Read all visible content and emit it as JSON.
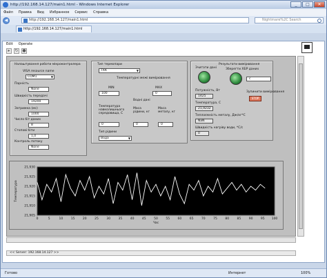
{
  "window": {
    "title": "http://192.168.14.127/main1.html - Windows Internet Explorer",
    "minimize": "_",
    "maximize": "□",
    "close": "✕"
  },
  "menubar": [
    "Файл",
    "Правка",
    "Вид",
    "Избранное",
    "Сервис",
    "Справка"
  ],
  "address": {
    "url": "http://192.168.14.127/main1.html",
    "search_placeholder": "Nightmare%2C Search"
  },
  "tab": {
    "label": "http://192.168.14.127/main1.html"
  },
  "labview": {
    "menu": [
      "Edit",
      "Operate"
    ],
    "panel_left": {
      "title": "Налаштування роботи мікроконтролера",
      "visa_label": "VISA resource name",
      "visa_value": "COM1",
      "parity_label": "Парність",
      "parity_value": "None",
      "baud_label": "Швидкість передачі",
      "baud_value": "19200",
      "delay_label": "Затримка (мс)",
      "delay_value": "1000",
      "databits_label": "Число біт даних",
      "databits_value": "8",
      "stopbits_label": "Стопові біти",
      "stopbits_value": "1,0",
      "flow_label": "Контроль потоку",
      "flow_value": "None"
    },
    "panel_middle": {
      "sensor_type_label": "Тип термопари",
      "sensor_type_value": "ТХК",
      "temp_range_label": "Температурні межі вимірювання",
      "min_label": "MIN",
      "min_value": "100",
      "max_label": "MAX",
      "max_value": "0",
      "water_section_label": "Водні дані",
      "water_temp_label": "Температура навколишнього середовища, С",
      "water_temp_value": "0",
      "mass_label": "Маса рідини, кг",
      "mass_value": "0",
      "metal_mass_label": "Маса металу, кг",
      "metal_mass_value": "0",
      "liquid_type_label": "Тип рідини",
      "liquid_type_value": "Вода"
    },
    "panel_right": {
      "title": "Результати вимірювання",
      "led1_label": "Зчитати дані",
      "led2_label": "Зберегти ХБР даних",
      "file_value": "c",
      "power_label": "Потужність, Вт",
      "power_value": "1425",
      "temp_label": "Температура, С",
      "temp_value": "21,9232",
      "stop_label": "Зупинити вимірювання",
      "stop_button": "STOP",
      "heat_label": "Теплоємність металу, Дж/кг*С",
      "heat_value": "NaN",
      "rate_label": "Швидкість нагріву води, *С/с",
      "rate_value": "0"
    },
    "status": "<< Server: 192.168.14.127 >>"
  },
  "statusbar": {
    "done": "Готово",
    "zone": "Интернет",
    "zoom": "100%"
  },
  "chart_data": {
    "type": "line",
    "xlabel": "Час",
    "ylabel": "Температура",
    "xlim": [
      0,
      100
    ],
    "ylim": [
      21.905,
      21.93
    ],
    "x_ticks": [
      0,
      5,
      10,
      15,
      20,
      25,
      30,
      35,
      40,
      45,
      50,
      55,
      60,
      65,
      70,
      75,
      80,
      85,
      90,
      95,
      100
    ],
    "y_ticks": [
      21.905,
      21.91,
      21.915,
      21.92,
      21.925,
      21.93
    ],
    "series": [
      {
        "color": "#ffffff",
        "x": [
          0,
          2,
          4,
          6,
          8,
          10,
          12,
          14,
          16,
          18,
          20,
          22,
          24,
          26,
          28,
          30,
          32,
          34,
          36,
          38,
          40,
          42,
          44,
          46,
          48,
          50,
          52,
          54,
          56,
          58,
          60,
          62,
          64,
          66,
          68,
          70,
          72,
          74,
          76,
          78,
          80,
          82,
          84,
          86,
          88,
          90,
          92,
          94,
          96
        ],
        "y": [
          21.922,
          21.913,
          21.921,
          21.917,
          21.924,
          21.912,
          21.926,
          21.919,
          21.915,
          21.923,
          21.918,
          21.925,
          21.914,
          21.92,
          21.916,
          21.924,
          21.911,
          21.922,
          21.918,
          21.926,
          21.913,
          21.927,
          21.91,
          21.923,
          21.917,
          21.921,
          21.915,
          21.92,
          21.913,
          21.925,
          21.916,
          21.911,
          21.921,
          21.918,
          21.923,
          21.915,
          21.92,
          21.917,
          21.924,
          21.916,
          21.919,
          21.922,
          21.918,
          21.921,
          21.917,
          21.92,
          21.918,
          21.921,
          21.919
        ]
      }
    ]
  }
}
